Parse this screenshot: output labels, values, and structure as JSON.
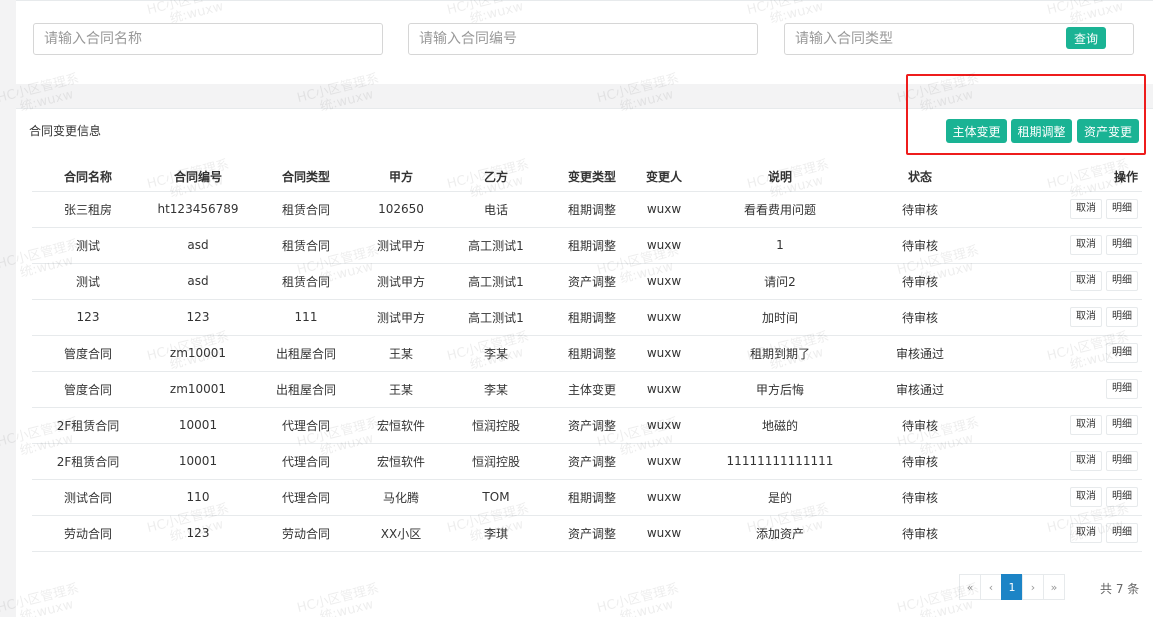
{
  "search": {
    "name_placeholder": "请输入合同名称",
    "code_placeholder": "请输入合同编号",
    "type_placeholder": "请输入合同类型",
    "query_label": "查询"
  },
  "list": {
    "title": "合同变更信息",
    "actions": [
      "主体变更",
      "租期调整",
      "资产变更"
    ],
    "columns": [
      "合同名称",
      "合同编号",
      "合同类型",
      "甲方",
      "乙方",
      "变更类型",
      "变更人",
      "说明",
      "状态",
      "操作"
    ],
    "rows": [
      {
        "name": "张三租房",
        "code": "ht123456789",
        "type": "租赁合同",
        "party_a": "102650",
        "party_b": "电话",
        "change_type": "租期调整",
        "changer": "wuxw",
        "desc": "看看费用问题",
        "status": "待审核",
        "ops": [
          "取消",
          "明细"
        ]
      },
      {
        "name": "测试",
        "code": "asd",
        "type": "租赁合同",
        "party_a": "测试甲方",
        "party_b": "高工测试1",
        "change_type": "租期调整",
        "changer": "wuxw",
        "desc": "1",
        "status": "待审核",
        "ops": [
          "取消",
          "明细"
        ]
      },
      {
        "name": "测试",
        "code": "asd",
        "type": "租赁合同",
        "party_a": "测试甲方",
        "party_b": "高工测试1",
        "change_type": "资产调整",
        "changer": "wuxw",
        "desc": "请问2",
        "status": "待审核",
        "ops": [
          "取消",
          "明细"
        ]
      },
      {
        "name": "123",
        "code": "123",
        "type": "111",
        "party_a": "测试甲方",
        "party_b": "高工测试1",
        "change_type": "租期调整",
        "changer": "wuxw",
        "desc": "加时间",
        "status": "待审核",
        "ops": [
          "取消",
          "明细"
        ]
      },
      {
        "name": "管度合同",
        "code": "zm10001",
        "type": "出租屋合同",
        "party_a": "王某",
        "party_b": "李某",
        "change_type": "租期调整",
        "changer": "wuxw",
        "desc": "租期到期了",
        "status": "审核通过",
        "ops": [
          "明细"
        ]
      },
      {
        "name": "管度合同",
        "code": "zm10001",
        "type": "出租屋合同",
        "party_a": "王某",
        "party_b": "李某",
        "change_type": "主体变更",
        "changer": "wuxw",
        "desc": "甲方后悔",
        "status": "审核通过",
        "ops": [
          "明细"
        ]
      },
      {
        "name": "2F租赁合同",
        "code": "10001",
        "type": "代理合同",
        "party_a": "宏恒软件",
        "party_b": "恒润控股",
        "change_type": "资产调整",
        "changer": "wuxw",
        "desc": "地磁的",
        "status": "待审核",
        "ops": [
          "取消",
          "明细"
        ]
      },
      {
        "name": "2F租赁合同",
        "code": "10001",
        "type": "代理合同",
        "party_a": "宏恒软件",
        "party_b": "恒润控股",
        "change_type": "资产调整",
        "changer": "wuxw",
        "desc": "11111111111111",
        "status": "待审核",
        "ops": [
          "取消",
          "明细"
        ]
      },
      {
        "name": "测试合同",
        "code": "110",
        "type": "代理合同",
        "party_a": "马化腾",
        "party_b": "TOM",
        "change_type": "租期调整",
        "changer": "wuxw",
        "desc": "是的",
        "status": "待审核",
        "ops": [
          "取消",
          "明细"
        ]
      },
      {
        "name": "劳动合同",
        "code": "123",
        "type": "劳动合同",
        "party_a": "XX小区",
        "party_b": "李琪",
        "change_type": "资产调整",
        "changer": "wuxw",
        "desc": "添加资产",
        "status": "待审核",
        "ops": [
          "取消",
          "明细"
        ]
      }
    ]
  },
  "pagination": {
    "first": "«",
    "prev": "‹",
    "current": "1",
    "next": "›",
    "last": "»",
    "total": "共 7 条"
  },
  "watermark": {
    "line1": "HC小区管理系",
    "line2": "统:wuxw"
  },
  "colors": {
    "accent": "#1ab394",
    "pager_active": "#1c84c6",
    "highlight": "#ee1c1c"
  }
}
